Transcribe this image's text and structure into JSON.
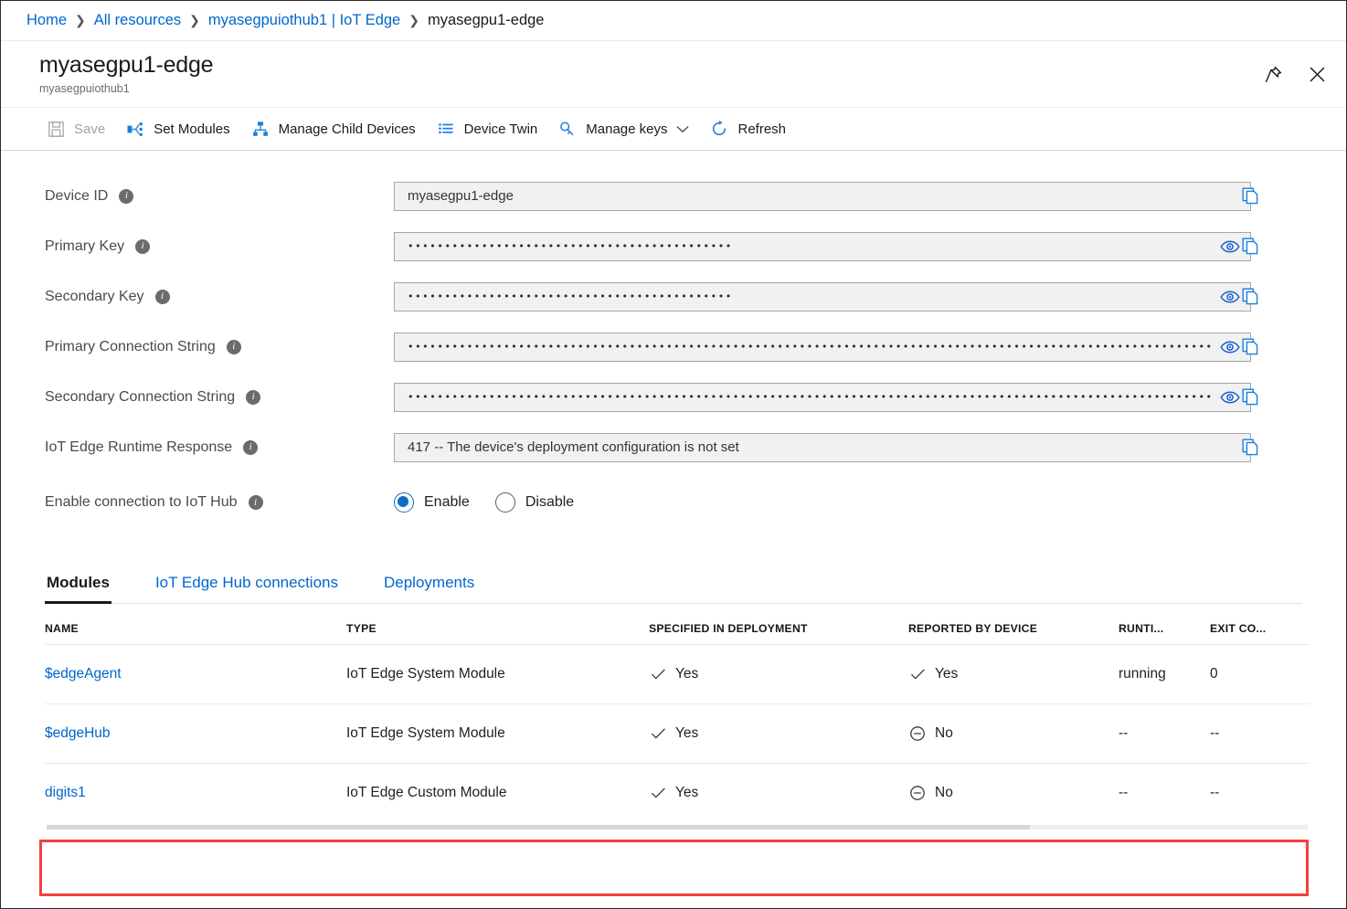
{
  "breadcrumb": {
    "items": [
      {
        "label": "Home",
        "link": true
      },
      {
        "label": "All resources",
        "link": true
      },
      {
        "label": "myasegpuiothub1 | IoT Edge",
        "link": true
      },
      {
        "label": "myasegpu1-edge",
        "link": false
      }
    ],
    "separator": "❯"
  },
  "header": {
    "title": "myasegpu1-edge",
    "subtitle": "myasegpuiothub1",
    "pin_icon": "pin-icon",
    "close_icon": "close-icon"
  },
  "toolbar": {
    "items": [
      {
        "label": "Save",
        "icon": "save-icon",
        "disabled": true,
        "chevron": false
      },
      {
        "label": "Set Modules",
        "icon": "set-modules-icon",
        "disabled": false,
        "chevron": false
      },
      {
        "label": "Manage Child Devices",
        "icon": "manage-child-devices-icon",
        "disabled": false,
        "chevron": false
      },
      {
        "label": "Device Twin",
        "icon": "device-twin-icon",
        "disabled": false,
        "chevron": false
      },
      {
        "label": "Manage keys",
        "icon": "key-icon",
        "disabled": false,
        "chevron": true
      },
      {
        "label": "Refresh",
        "icon": "refresh-icon",
        "disabled": false,
        "chevron": false
      }
    ]
  },
  "form": {
    "fields": [
      {
        "label": "Device ID",
        "type": "text",
        "value": "myasegpu1-edge",
        "masked": false,
        "eye": false,
        "copy": true
      },
      {
        "label": "Primary Key",
        "type": "password",
        "value": "••••••••••••••••••••••••••••••••••••••••••••",
        "masked": true,
        "eye": true,
        "copy": true
      },
      {
        "label": "Secondary Key",
        "type": "password",
        "value": "••••••••••••••••••••••••••••••••••••••••••••",
        "masked": true,
        "eye": true,
        "copy": true
      },
      {
        "label": "Primary Connection String",
        "type": "password",
        "value": "•••••••••••••••••••••••••••••••••••••••••••••••••••••••••••••••••••••••••••••••••••••••••••••••••••••••••••••••••••••••••••••••••••••…",
        "masked": true,
        "eye": true,
        "copy": true
      },
      {
        "label": "Secondary Connection String",
        "type": "password",
        "value": "•••••••••••••••••••••••••••••••••••••••••••••••••••••••••••••••••••••••••••••••••••••••••••••••••••••••••••••••••••••••••••••••••••••…",
        "masked": true,
        "eye": true,
        "copy": true
      },
      {
        "label": "IoT Edge Runtime Response",
        "type": "text",
        "value": "417 -- The device's deployment configuration is not set",
        "masked": false,
        "eye": false,
        "copy": true
      }
    ],
    "connection_toggle": {
      "label": "Enable connection to IoT Hub",
      "options": [
        {
          "label": "Enable",
          "selected": true
        },
        {
          "label": "Disable",
          "selected": false
        }
      ]
    },
    "eye_icon": "eye-icon",
    "copy_icon": "copy-icon",
    "info_icon": "info-icon",
    "info_glyph": "i"
  },
  "tabs": [
    {
      "label": "Modules",
      "active": true
    },
    {
      "label": "IoT Edge Hub connections",
      "active": false
    },
    {
      "label": "Deployments",
      "active": false
    }
  ],
  "table": {
    "columns": [
      "NAME",
      "TYPE",
      "SPECIFIED IN DEPLOYMENT",
      "REPORTED BY DEVICE",
      "RUNTI...",
      "EXIT CO..."
    ],
    "rows": [
      {
        "name": "$edgeAgent",
        "type": "IoT Edge System Module",
        "specified_in_deployment": "Yes",
        "specified_icon": "check-icon",
        "reported_by_device": "Yes",
        "reported_icon": "check-icon",
        "runtime_status": "running",
        "exit_code": "0",
        "highlighted": false
      },
      {
        "name": "$edgeHub",
        "type": "IoT Edge System Module",
        "specified_in_deployment": "Yes",
        "specified_icon": "check-icon",
        "reported_by_device": "No",
        "reported_icon": "circle-minus-icon",
        "runtime_status": "--",
        "exit_code": "--",
        "highlighted": false
      },
      {
        "name": "digits1",
        "type": "IoT Edge Custom Module",
        "specified_in_deployment": "Yes",
        "specified_icon": "check-icon",
        "reported_by_device": "No",
        "reported_icon": "circle-minus-icon",
        "runtime_status": "--",
        "exit_code": "--",
        "highlighted": true
      }
    ]
  },
  "colors": {
    "link": "#0066cc",
    "accent": "#0a6fc2",
    "highlight": "#f2413f",
    "field_bg": "#f1f1f1",
    "field_border": "#a6a6a6",
    "info_bg": "#6b6b6b",
    "label": "#4a4a4a"
  }
}
